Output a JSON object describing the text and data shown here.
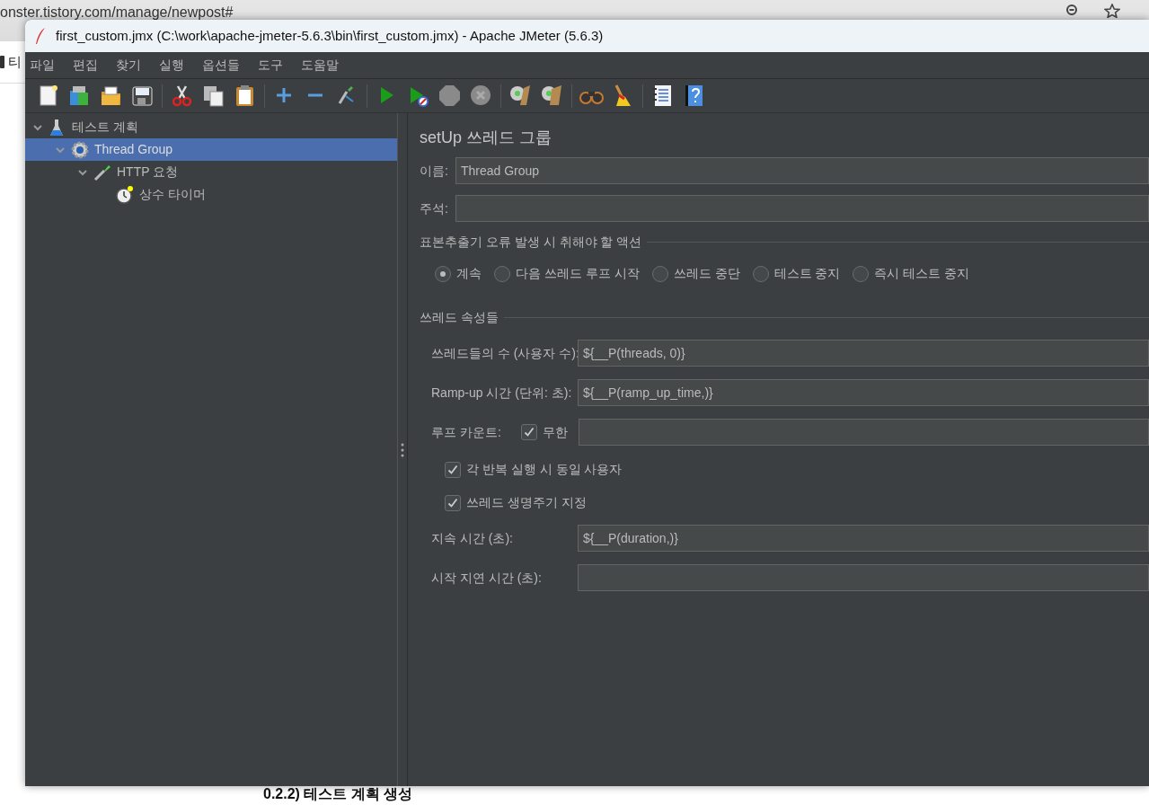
{
  "browser": {
    "url": "onster.tistory.com/manage/newpost#",
    "tab_text": "티",
    "heading": "0.2.2) 테스트 계획 생성"
  },
  "window": {
    "title": "first_custom.jmx (C:\\work\\apache-jmeter-5.6.3\\bin\\first_custom.jmx) - Apache JMeter (5.6.3)"
  },
  "menu": [
    "파일",
    "편집",
    "찾기",
    "실행",
    "옵션들",
    "도구",
    "도움말"
  ],
  "tree": [
    {
      "label": "테스트 계획",
      "kind": "plan",
      "expanded": true,
      "selected": false,
      "children": [
        {
          "label": "Thread Group",
          "kind": "threads",
          "expanded": true,
          "selected": true,
          "children": [
            {
              "label": "HTTP 요청",
              "kind": "sampler",
              "expanded": true,
              "selected": false,
              "children": [
                {
                  "label": "상수 타이머",
                  "kind": "timer",
                  "selected": false
                }
              ]
            }
          ]
        }
      ]
    }
  ],
  "panel": {
    "title": "setUp 쓰레드 그룹",
    "name_label": "이름:",
    "name_value": "Thread Group",
    "comment_label": "주석:",
    "error_action": {
      "legend": "표본추출기 오류 발생 시 취해야 할 액션",
      "options": [
        {
          "label": "계속",
          "selected": true
        },
        {
          "label": "다음 쓰레드 루프 시작",
          "selected": false
        },
        {
          "label": "쓰레드 중단",
          "selected": false
        },
        {
          "label": "테스트 중지",
          "selected": false
        },
        {
          "label": "즉시 테스트 중지",
          "selected": false
        }
      ]
    },
    "thread_props": {
      "legend": "쓰레드 속성들",
      "fields": [
        {
          "kind": "text",
          "label": "쓰레드들의 수 (사용자 수):",
          "value": "${__P(threads, 0)}"
        },
        {
          "kind": "text",
          "label": "Ramp-up 시간 (단위: 초):",
          "value": "${__P(ramp_up_time,)}"
        },
        {
          "kind": "loop",
          "label": "루프 카운트:",
          "check_label": "무한",
          "checked": true
        },
        {
          "kind": "checkbox",
          "label": "각 반복 실행 시 동일 사용자",
          "checked": true
        },
        {
          "kind": "checkbox",
          "label": "쓰레드 생명주기 지정",
          "checked": true
        },
        {
          "kind": "text",
          "label": "지속 시간 (초):",
          "value": "${__P(duration,)}"
        },
        {
          "kind": "text",
          "label": "시작 지연 시간 (초):"
        }
      ]
    }
  }
}
